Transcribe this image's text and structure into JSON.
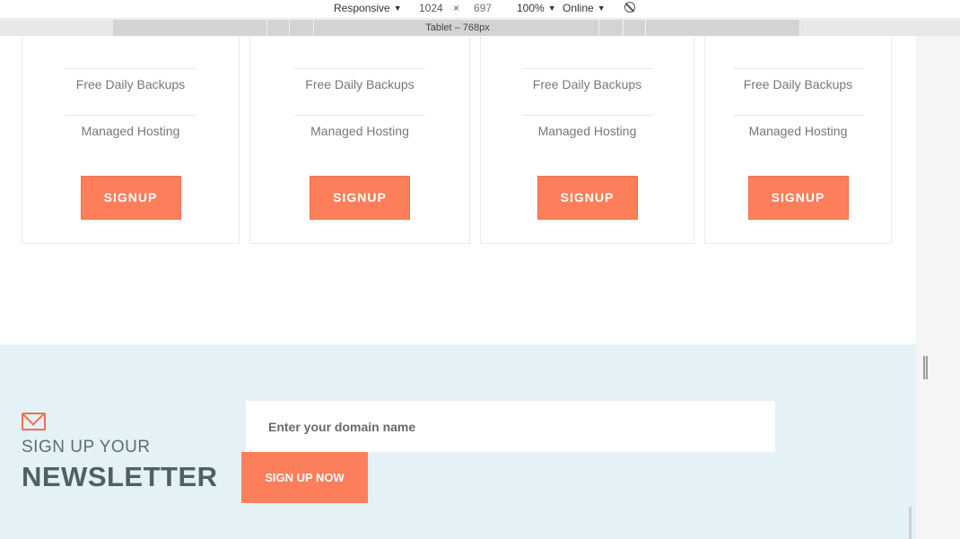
{
  "devtools": {
    "device_mode": "Responsive",
    "width": "1024",
    "times": "×",
    "height": "697",
    "zoom": "100%",
    "network": "Online",
    "media_query_label": "Tablet – 768px"
  },
  "pricing": {
    "cards": [
      {
        "features": [
          "Free Daily Backups",
          "Managed Hosting"
        ],
        "button": "SIGNUP"
      },
      {
        "features": [
          "Free Daily Backups",
          "Managed Hosting"
        ],
        "button": "SIGNUP"
      },
      {
        "features": [
          "Free Daily Backups",
          "Managed Hosting"
        ],
        "button": "SIGNUP"
      },
      {
        "features": [
          "Free Daily Backups",
          "Managed Hosting"
        ],
        "button": "SIGNUP"
      }
    ]
  },
  "newsletter": {
    "subtitle": "SIGN UP YOUR",
    "title": "NEWSLETTER",
    "input_placeholder": "Enter your domain name",
    "button": "SIGN UP NOW"
  },
  "colors": {
    "accent": "#fd7e5b",
    "newsletter_bg": "#e4f2f7",
    "heading": "#4d6167"
  },
  "icons": {
    "mail": "envelope-icon",
    "rotate": "rotate-disabled-icon"
  }
}
